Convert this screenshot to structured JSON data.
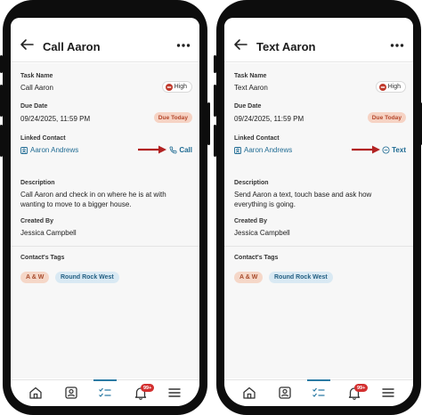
{
  "screens": [
    {
      "header": {
        "title": "Call Aaron"
      },
      "task": {
        "name_label": "Task Name",
        "name_value": "Call Aaron",
        "priority": "High",
        "due_label": "Due Date",
        "due_value": "09/24/2025, 11:59 PM",
        "due_badge": "Due Today",
        "contact_label": "Linked Contact",
        "contact_value": "Aaron Andrews",
        "action": "Call",
        "action_icon": "phone-icon",
        "description_label": "Description",
        "description_value": "Call Aaron and check in on where he is at with wanting to move to a bigger house.",
        "created_label": "Created By",
        "created_value": "Jessica Campbell",
        "tags_label": "Contact's Tags",
        "tags": [
          "A & W",
          "Round Rock West"
        ]
      },
      "tabbar": {
        "notifications_badge": "99+"
      }
    },
    {
      "header": {
        "title": "Text Aaron"
      },
      "task": {
        "name_label": "Task Name",
        "name_value": "Text Aaron",
        "priority": "High",
        "due_label": "Due Date",
        "due_value": "09/24/2025, 11:59 PM",
        "due_badge": "Due Today",
        "contact_label": "Linked Contact",
        "contact_value": "Aaron Andrews",
        "action": "Text",
        "action_icon": "chat-bubble-icon",
        "description_label": "Description",
        "description_value": "Send Aaron a text, touch base and ask how everything is going.",
        "created_label": "Created By",
        "created_value": "Jessica Campbell",
        "tags_label": "Contact's Tags",
        "tags": [
          "A & W",
          "Round Rock West"
        ]
      },
      "tabbar": {
        "notifications_badge": "99+"
      }
    }
  ],
  "colors": {
    "accent": "#1f6b93",
    "due_badge_bg": "#f6d3c4",
    "due_badge_text": "#b4462a",
    "priority_high": "#c0392b",
    "arrow": "#b22222",
    "notification_badge": "#d32f2f"
  },
  "icons": {
    "back": "arrow-left-icon",
    "more": "more-horizontal-icon",
    "priority": "priority-high-icon",
    "contact": "contact-card-icon",
    "tabs": [
      "home-icon",
      "contacts-icon",
      "tasks-icon",
      "bell-icon",
      "menu-icon"
    ]
  }
}
